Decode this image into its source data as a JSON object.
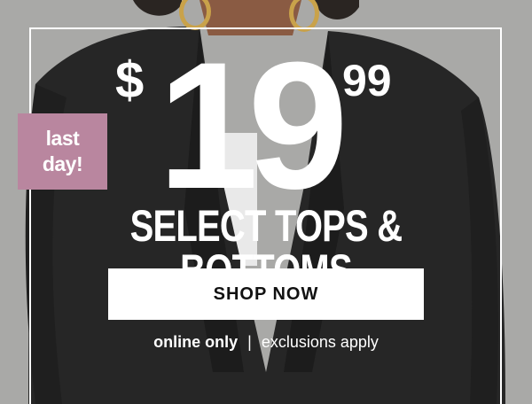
{
  "promo": {
    "badge": {
      "line1": "last",
      "line2": "day!"
    },
    "price": {
      "currency": "$",
      "dollars": "19",
      "cents": "99"
    },
    "headline": "SELECT TOPS & BOTTOMS",
    "cta_label": "SHOP NOW",
    "fine_print": {
      "bold": "online only",
      "separator": "|",
      "regular": "exclusions apply"
    }
  },
  "colors": {
    "background_gray": "#a9a9a7",
    "jacket_black": "#262626",
    "badge_mauve": "#b9869f",
    "cta_background": "#ffffff",
    "cta_text": "#111111",
    "text_white": "#ffffff"
  }
}
